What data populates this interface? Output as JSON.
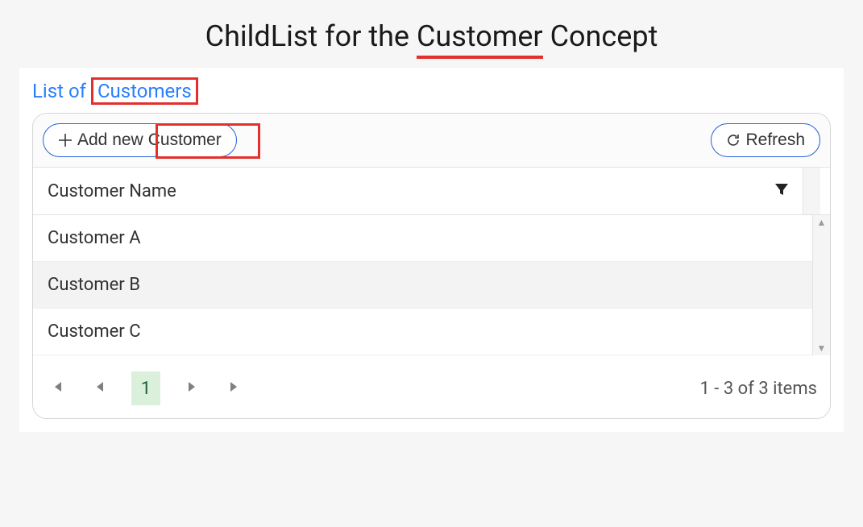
{
  "title": {
    "prefix": "ChildList for the ",
    "underlined": "Customer",
    "suffix": " Concept"
  },
  "caption": {
    "prefix": "List of ",
    "boxed": "Customers"
  },
  "toolbar": {
    "add_prefix": "Add new ",
    "add_entity": "Customer",
    "refresh_label": "Refresh"
  },
  "columns": {
    "name": "Customer Name"
  },
  "rows": [
    {
      "name": "Customer A"
    },
    {
      "name": "Customer B"
    },
    {
      "name": "Customer C"
    }
  ],
  "pager": {
    "current": "1",
    "info": "1 - 3 of 3 items"
  }
}
